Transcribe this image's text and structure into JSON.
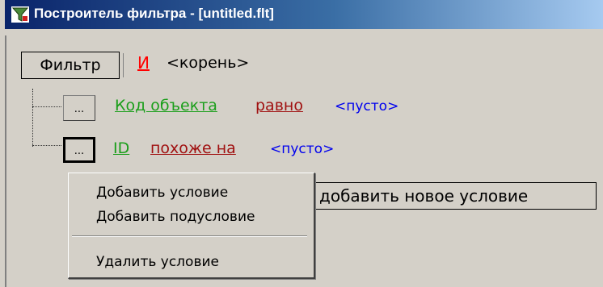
{
  "window": {
    "title": "Построитель фильтра - [untitled.flt]",
    "icon": "filter-builder-icon"
  },
  "root": {
    "button_label": "Фильтр",
    "operator": "И",
    "value": "<корень>"
  },
  "conditions": [
    {
      "button_label": "...",
      "field": "Код объекта",
      "operator": "равно",
      "value": "<пусто>"
    },
    {
      "button_label": "...",
      "field": "ID",
      "operator": "похоже на",
      "value": "<пусто>"
    }
  ],
  "add_hint": "добавить новое условие",
  "context_menu": {
    "items": [
      "Добавить условие",
      "Добавить подусловие",
      "Удалить условие"
    ]
  },
  "colors": {
    "field": "#1a9e1a",
    "operator": "#a01010",
    "value": "#0000ee",
    "root_operator": "#ff0000"
  }
}
